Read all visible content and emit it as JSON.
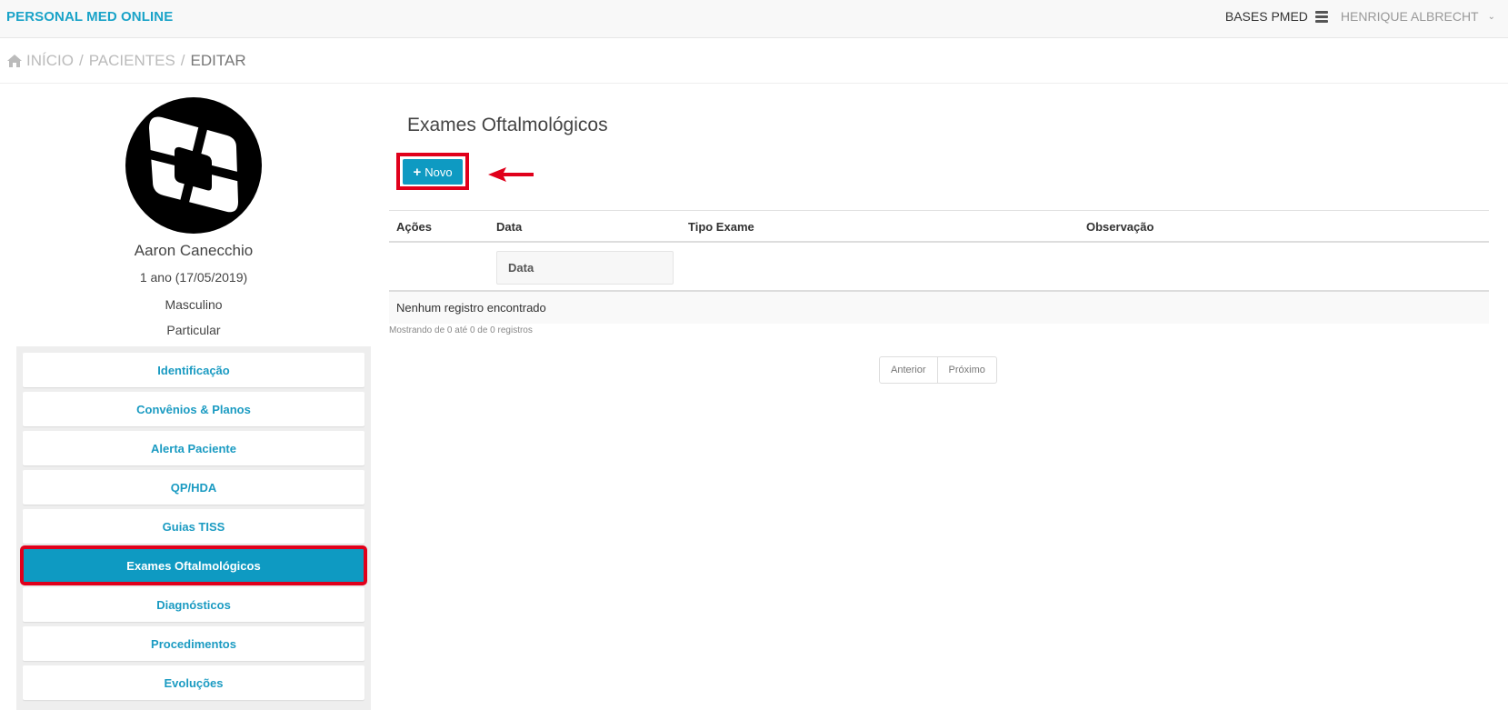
{
  "navbar": {
    "brand": "PERSONAL MED ONLINE",
    "bases": "BASES PMED",
    "user": "HENRIQUE ALBRECHT",
    "icons": [
      "database-icon",
      "chevron-down-icon"
    ]
  },
  "breadcrumb": {
    "home": "INÍCIO",
    "sep1": "/",
    "patients": "PACIENTES",
    "sep2": "/",
    "current": "EDITAR"
  },
  "patient": {
    "name": "Aaron Canecchio",
    "age": "1 ano (17/05/2019)",
    "sex": "Masculino",
    "plan": "Particular"
  },
  "menu": {
    "items": [
      {
        "label": "Identificação"
      },
      {
        "label": "Convênios & Planos"
      },
      {
        "label": "Alerta Paciente"
      },
      {
        "label": "QP/HDA"
      },
      {
        "label": "Guias TISS"
      },
      {
        "label": "Exames Oftalmológicos",
        "active": true
      },
      {
        "label": "Diagnósticos"
      },
      {
        "label": "Procedimentos"
      },
      {
        "label": "Evoluções"
      }
    ]
  },
  "main": {
    "title": "Exames Oftalmológicos",
    "new_button": "Novo",
    "table": {
      "columns": [
        "Ações",
        "Data",
        "Tipo Exame",
        "Observação"
      ],
      "filter_placeholder": "Data",
      "empty": "Nenhum registro encontrado"
    },
    "info": "Mostrando de 0 até 0 de 0 registros",
    "pager": {
      "prev": "Anterior",
      "next": "Próximo"
    }
  },
  "colors": {
    "brand": "#1aa3c8",
    "primary": "#0e9ac2",
    "highlight": "#e0001b"
  }
}
